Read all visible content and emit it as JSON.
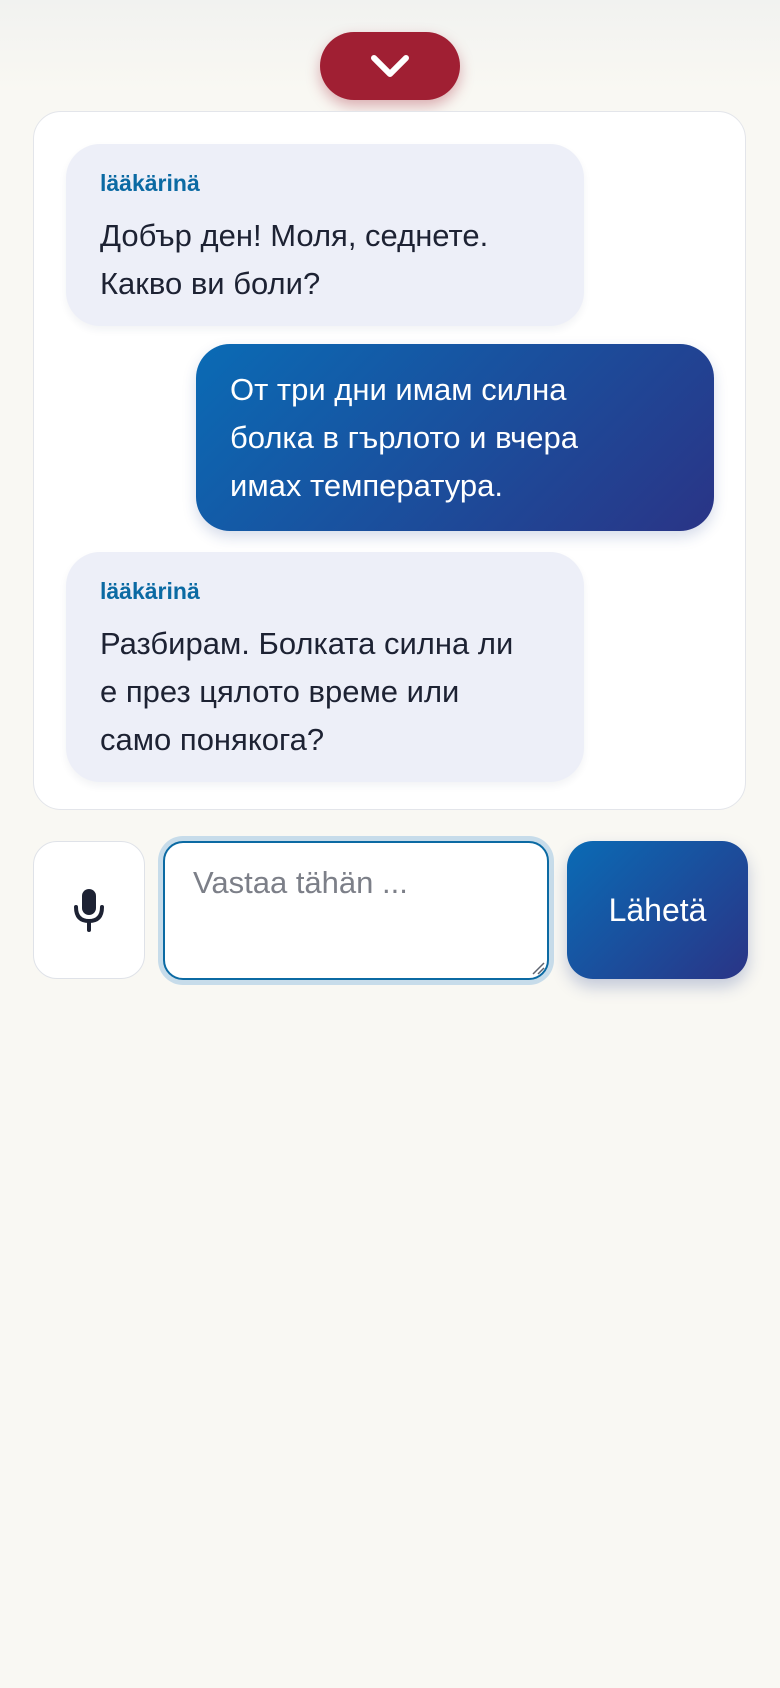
{
  "header": {
    "collapse_icon": "chevron-down-icon",
    "accent_color": "#a01f33"
  },
  "chat": {
    "messages": [
      {
        "role": "doctor",
        "speaker": "lääkärinä",
        "text": "Добър ден! Моля, седнете.\nКакво ви боли?"
      },
      {
        "role": "user",
        "text": "От три дни имам силна\nболка в гърлото и вчера\nимах температура."
      },
      {
        "role": "doctor",
        "speaker": "lääkärinä",
        "text": "Разбирам. Болката силна ли\nе през цялото време или\nсамо понякога?"
      }
    ]
  },
  "composer": {
    "mic_icon": "microphone-icon",
    "placeholder": "Vastaa tähän ...",
    "value": "",
    "send_label": "Lähetä",
    "primary_color": "#0a6bb5"
  }
}
